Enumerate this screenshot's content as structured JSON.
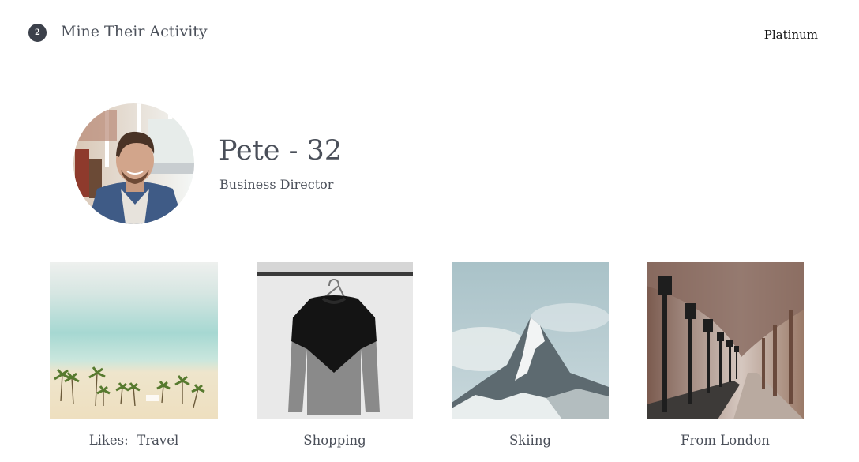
{
  "header": {
    "step_number": "2",
    "step_title": "Mine Their Activity",
    "tier": "Platinum"
  },
  "profile": {
    "name_age": "Pete - 32",
    "role": "Business Director",
    "avatar_icon": "person-photo"
  },
  "interests": [
    {
      "label": "Likes:  Travel",
      "image": "beach-palm-trees"
    },
    {
      "label": "Shopping",
      "image": "sweater-on-hanger"
    },
    {
      "label": "Skiing",
      "image": "snowy-mountain-peak"
    },
    {
      "label": "From London",
      "image": "tree-lined-lamp-post-path"
    }
  ],
  "colors": {
    "text": "#4a4f59",
    "badge": "#3c414b"
  }
}
